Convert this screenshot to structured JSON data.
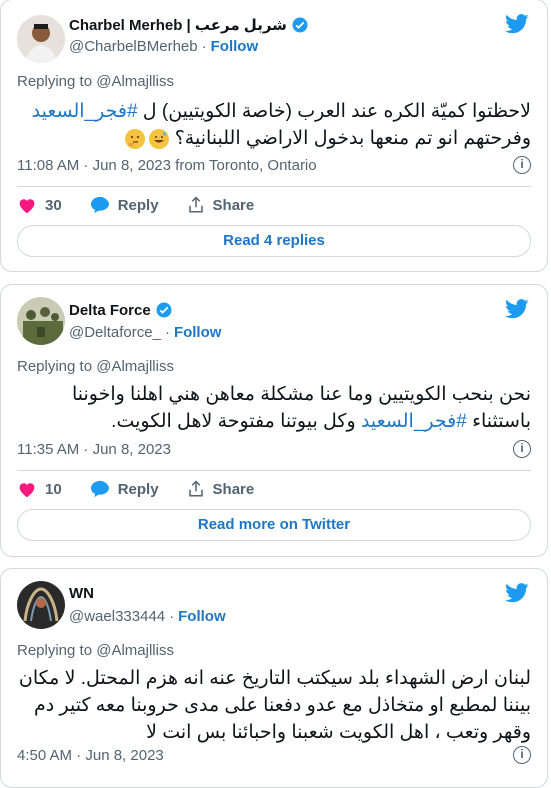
{
  "tweets": [
    {
      "name": "Charbel Merheb | شربل مرعب",
      "handle": "@CharbelBMerheb",
      "dot": "·",
      "follow": "Follow",
      "replying_to": "Replying to @Almajlliss",
      "text_part1": "لاحظتوا كميّة الكره عند العرب (خاصة الكويتيين) ل ",
      "hashtag": "#فجر_السعيد",
      "text_part2": " وفرحتهم انو تم منعها بدخول الاراضي اللبنانية؟",
      "emojis": [
        "sweat-smile-emoji",
        "thinking-emoji"
      ],
      "meta": "11:08 AM · Jun 8, 2023 from Toronto, Ontario",
      "likes": "30",
      "reply": "Reply",
      "share": "Share",
      "footer_button": "Read 4 replies"
    },
    {
      "name": "Delta Force",
      "handle": "@Deltaforce_",
      "dot": "·",
      "follow": "Follow",
      "replying_to": "Replying to @Almajlliss",
      "text_part1": "نحن بنحب الكويتيين وما عنا مشكلة معاهن هني اهلنا واخوننا باستثناء ",
      "hashtag": "#فجر_السعيد",
      "text_part2": " وكل بيوتنا مفتوحة لاهل الكويت.",
      "meta": "11:35 AM · Jun 8, 2023",
      "likes": "10",
      "reply": "Reply",
      "share": "Share",
      "footer_button": "Read more on Twitter"
    },
    {
      "name": "WN",
      "handle": "@wael333444",
      "dot": "·",
      "follow": "Follow",
      "replying_to": "Replying to @Almajlliss",
      "text": "لبنان ارض الشهداء بلد سيكتب التاريخ عنه انه هزم المحتل. لا مكان بيننا لمطبع او متخاذل مع عدو دفعنا على مدى حروبنا معه كتير دم وقهر وتعب ، اهل الكويت شعبنا واحبائنا بس انت لا",
      "meta": "4:50 AM · Jun 8, 2023"
    }
  ],
  "colors": {
    "link": "#1d77c8",
    "muted": "#536471",
    "like": "#f91880",
    "bird": "#1d9bf0",
    "verified": "#1d9bf0"
  }
}
